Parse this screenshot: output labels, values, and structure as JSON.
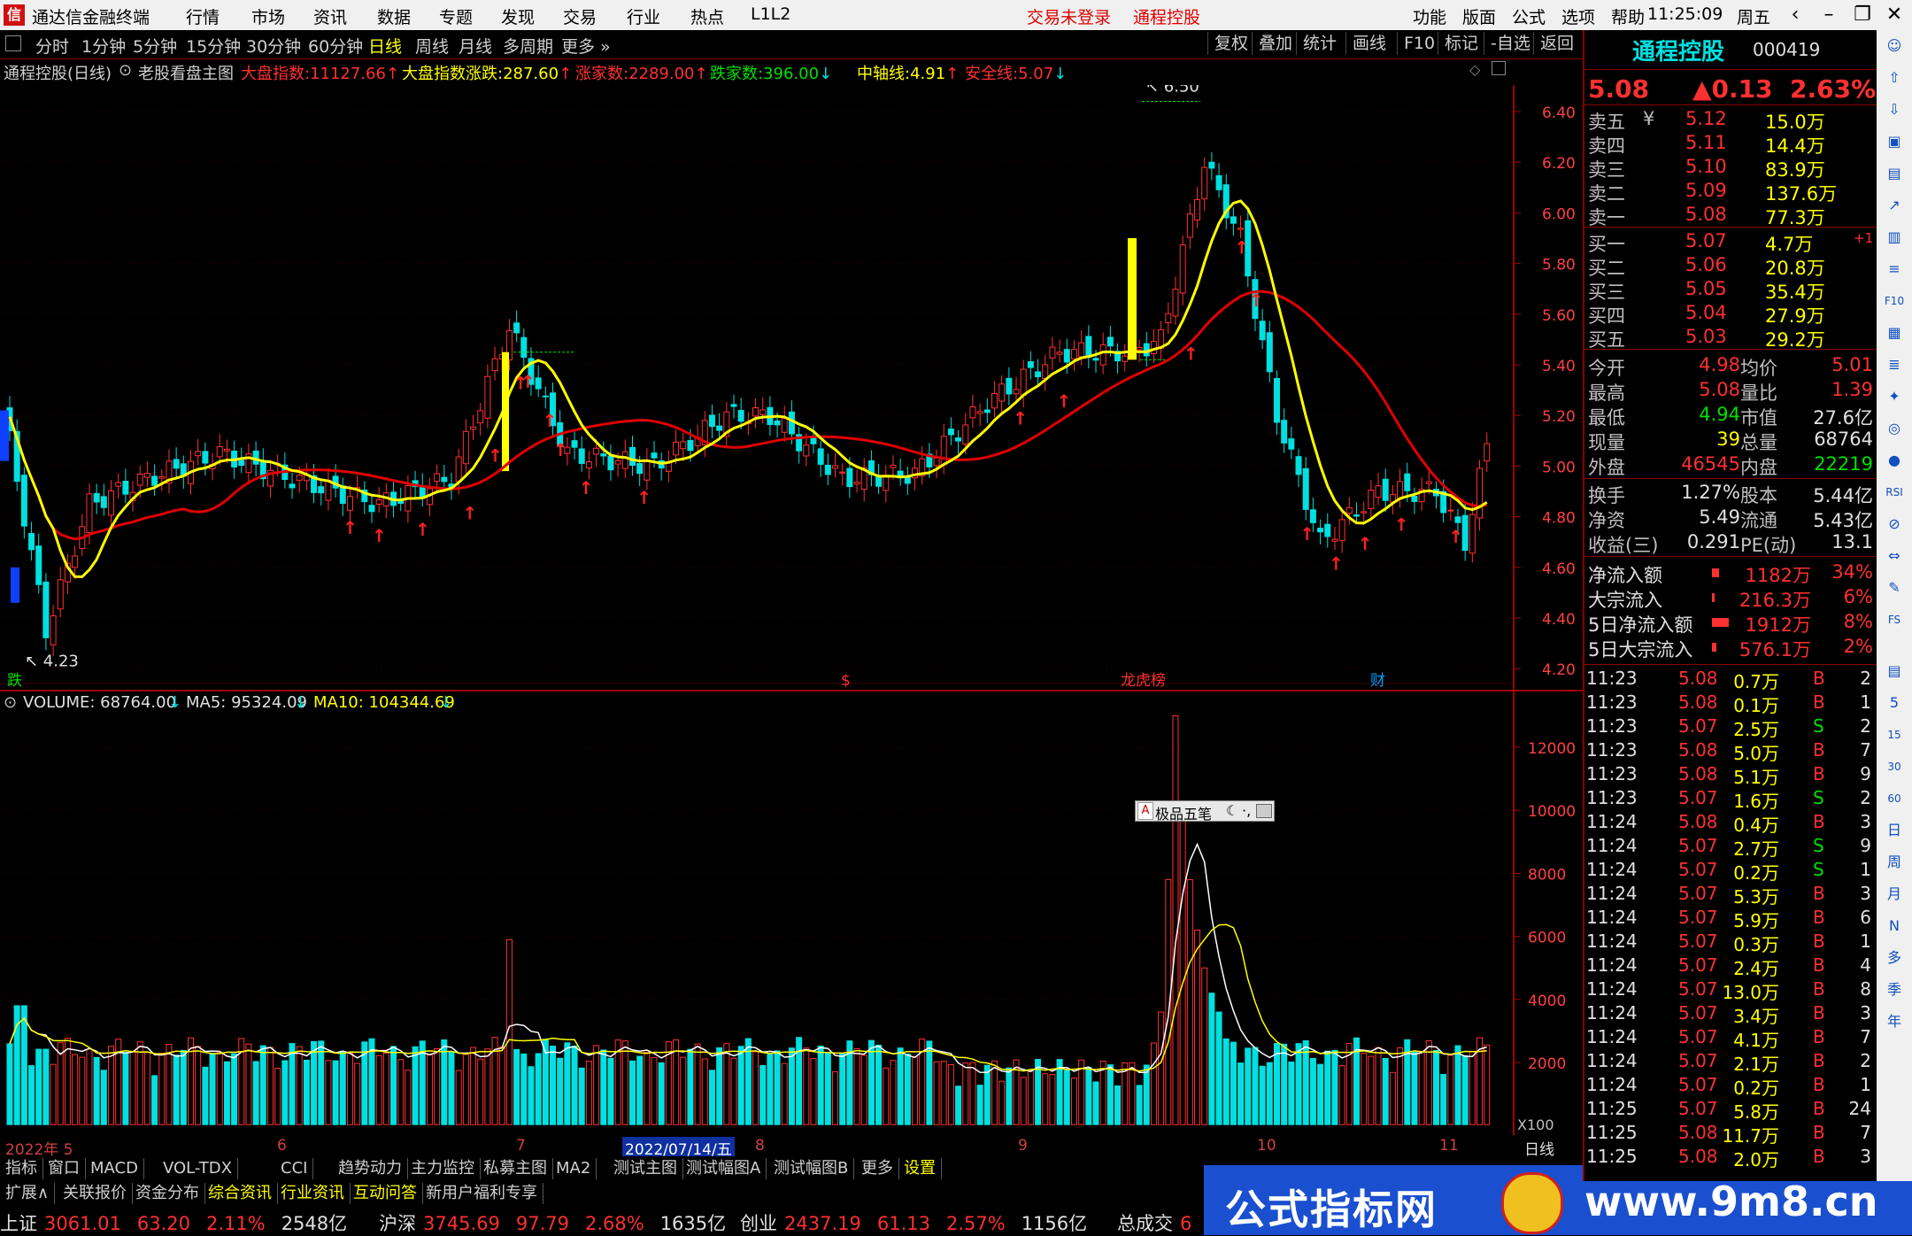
{
  "menubar": {
    "app_title": "通达信金融终端",
    "items": [
      "行情",
      "市场",
      "资讯",
      "数据",
      "专题",
      "发现",
      "交易",
      "行业",
      "热点",
      "L1L2"
    ],
    "login_status": "交易未登录",
    "stock_link": "通程控股",
    "right_items": [
      "功能",
      "版面",
      "公式",
      "选项",
      "帮助"
    ],
    "time": "11:25:09",
    "weekday": "周五"
  },
  "toolbar": {
    "periods": [
      "分时",
      "1分钟",
      "5分钟",
      "15分钟",
      "30分钟",
      "60分钟",
      "日线",
      "周线",
      "月线",
      "多周期",
      "更多 »"
    ],
    "active_period": "日线",
    "right_buttons": [
      "复权",
      "叠加",
      "统计",
      "画线",
      "F10",
      "标记",
      "-自选",
      "返回"
    ]
  },
  "chart_info": {
    "stock_period": "通程控股(日线)",
    "template": "老股看盘主图",
    "fields": [
      {
        "label": "大盘指数:",
        "value": "11127.66",
        "arrow": "↑",
        "label_color": "#ff3030",
        "value_color": "#ff3030"
      },
      {
        "label": "大盘指数涨跌:",
        "value": "287.60",
        "arrow": "↑",
        "label_color": "#ffff00",
        "value_color": "#ffff00"
      },
      {
        "label": "涨家数:",
        "value": "2289.00",
        "arrow": "↑",
        "label_color": "#ff3030",
        "value_color": "#ff3030"
      },
      {
        "label": "跌家数:",
        "value": "396.00",
        "arrow": "↓",
        "label_color": "#00e000",
        "value_color": "#00e000"
      },
      {
        "label": "中轴线:",
        "value": "4.91",
        "arrow": "↑",
        "label_color": "#ffff00",
        "value_color": "#ffff00"
      },
      {
        "label": "安全线:",
        "value": "5.07",
        "arrow": "↓",
        "label_color": "#ff3030",
        "value_color": "#ff3030"
      }
    ]
  },
  "volume_info": {
    "volume": "VOLUME: 68764.00",
    "ma5": "MA5: 95324.09",
    "ma10": "MA10: 104344.69"
  },
  "price_axis": [
    "6.40",
    "6.20",
    "6.00",
    "5.80",
    "5.60",
    "5.40",
    "5.20",
    "5.00",
    "4.80",
    "4.60",
    "4.40",
    "4.20"
  ],
  "volume_axis": [
    "12000",
    "10000",
    "8000",
    "6000",
    "4000",
    "2000"
  ],
  "volume_unit": "X100",
  "x_axis": {
    "labels": [
      "2022年 5",
      "6",
      "7",
      "8",
      "9",
      "10",
      "11"
    ],
    "cursor_date": "2022/07/14/五",
    "period": "日线"
  },
  "annotations": {
    "high": "6.50",
    "low": "4.23",
    "events": [
      "跌",
      "$",
      "龙虎榜",
      "财"
    ],
    "ime_label": "极品五笔"
  },
  "bottom_tabs": [
    "指标",
    "窗口",
    "MACD",
    "VOL-TDX",
    "CCI",
    "趋势动力",
    "主力监控",
    "私募主图",
    "MA2",
    "测试主图",
    "测试幅图A",
    "测试幅图B",
    "更多",
    "设置"
  ],
  "bottom_tabs2": [
    "扩展∧",
    "关联报价",
    "资金分布",
    "综合资讯",
    "行业资讯",
    "互动问答",
    "新用户福利专享"
  ],
  "status_bar": [
    {
      "name": "上证",
      "value": "3061.01",
      "change": "63.20",
      "pct": "2.11%",
      "amount": "2548亿"
    },
    {
      "name": "沪深",
      "value": "3745.69",
      "change": "97.79",
      "pct": "2.68%",
      "amount": "1635亿"
    },
    {
      "name": "创业",
      "value": "2437.19",
      "change": "61.13",
      "pct": "2.57%",
      "amount": "1156亿"
    },
    {
      "name": "总成交",
      "value": "6",
      "change": "",
      "pct": "",
      "amount": ""
    }
  ],
  "banner": {
    "left": "公式指标网",
    "right": "www.9m8.cn"
  },
  "quote": {
    "name": "通程控股",
    "code": "000419",
    "price": "5.08",
    "change": "▲0.13",
    "pct": "2.63%",
    "sells": [
      {
        "label": "卖五",
        "price": "5.12",
        "vol": "15.0万"
      },
      {
        "label": "卖四",
        "price": "5.11",
        "vol": "14.4万"
      },
      {
        "label": "卖三",
        "price": "5.10",
        "vol": "83.9万"
      },
      {
        "label": "卖二",
        "price": "5.09",
        "vol": "137.6万"
      },
      {
        "label": "卖一",
        "price": "5.08",
        "vol": "77.3万"
      }
    ],
    "sell_mark": "¥",
    "buys": [
      {
        "label": "买一",
        "price": "5.07",
        "vol": "4.7万",
        "extra": "+1"
      },
      {
        "label": "买二",
        "price": "5.06",
        "vol": "20.8万",
        "extra": ""
      },
      {
        "label": "买三",
        "price": "5.05",
        "vol": "35.4万",
        "extra": ""
      },
      {
        "label": "买四",
        "price": "5.04",
        "vol": "27.9万",
        "extra": ""
      },
      {
        "label": "买五",
        "price": "5.03",
        "vol": "29.2万",
        "extra": ""
      }
    ],
    "stats": [
      {
        "l1": "今开",
        "v1": "4.98",
        "c1": "#ff3030",
        "l2": "均价",
        "v2": "5.01",
        "c2": "#ff3030"
      },
      {
        "l1": "最高",
        "v1": "5.08",
        "c1": "#ff3030",
        "l2": "量比",
        "v2": "1.39",
        "c2": "#ff3030"
      },
      {
        "l1": "最低",
        "v1": "4.94",
        "c1": "#00e000",
        "l2": "市值",
        "v2": "27.6亿",
        "c2": "#e0e0e0"
      },
      {
        "l1": "现量",
        "v1": "39",
        "c1": "#ffff00",
        "l2": "总量",
        "v2": "68764",
        "c2": "#e0e0e0"
      },
      {
        "l1": "外盘",
        "v1": "46545",
        "c1": "#ff3030",
        "l2": "内盘",
        "v2": "22219",
        "c2": "#00e000"
      }
    ],
    "stats2": [
      {
        "l1": "换手",
        "v1": "1.27%",
        "l2": "股本",
        "v2": "5.44亿"
      },
      {
        "l1": "净资",
        "v1": "5.49",
        "l2": "流通",
        "v2": "5.43亿"
      },
      {
        "l1": "收益(三)",
        "v1": "0.291",
        "l2": "PE(动)",
        "v2": "13.1"
      }
    ],
    "flows": [
      {
        "label": "净流入额",
        "value": "1182万",
        "pct": "34%",
        "bar": 0.34
      },
      {
        "label": "大宗流入",
        "value": "216.3万",
        "pct": "6%",
        "bar": 0.06
      },
      {
        "label": "5日净流入额",
        "value": "1912万",
        "pct": "8%",
        "bar": 0.8
      },
      {
        "label": "5日大宗流入",
        "value": "576.1万",
        "pct": "2%",
        "bar": 0.2
      }
    ]
  },
  "ticks": [
    {
      "t": "11:23",
      "p": "5.08",
      "v": "0.7万",
      "s": "B",
      "n": "2"
    },
    {
      "t": "11:23",
      "p": "5.08",
      "v": "0.1万",
      "s": "B",
      "n": "1"
    },
    {
      "t": "11:23",
      "p": "5.07",
      "v": "2.5万",
      "s": "S",
      "n": "2"
    },
    {
      "t": "11:23",
      "p": "5.08",
      "v": "5.0万",
      "s": "B",
      "n": "7"
    },
    {
      "t": "11:23",
      "p": "5.08",
      "v": "5.1万",
      "s": "B",
      "n": "9"
    },
    {
      "t": "11:23",
      "p": "5.07",
      "v": "1.6万",
      "s": "S",
      "n": "2"
    },
    {
      "t": "11:24",
      "p": "5.08",
      "v": "0.4万",
      "s": "B",
      "n": "3"
    },
    {
      "t": "11:24",
      "p": "5.07",
      "v": "2.7万",
      "s": "S",
      "n": "9"
    },
    {
      "t": "11:24",
      "p": "5.07",
      "v": "0.2万",
      "s": "S",
      "n": "1"
    },
    {
      "t": "11:24",
      "p": "5.07",
      "v": "5.3万",
      "s": "B",
      "n": "3"
    },
    {
      "t": "11:24",
      "p": "5.07",
      "v": "5.9万",
      "s": "B",
      "n": "6"
    },
    {
      "t": "11:24",
      "p": "5.07",
      "v": "0.3万",
      "s": "B",
      "n": "1"
    },
    {
      "t": "11:24",
      "p": "5.07",
      "v": "2.4万",
      "s": "B",
      "n": "4"
    },
    {
      "t": "11:24",
      "p": "5.07",
      "v": "13.0万",
      "s": "B",
      "n": "8"
    },
    {
      "t": "11:24",
      "p": "5.07",
      "v": "3.4万",
      "s": "B",
      "n": "3"
    },
    {
      "t": "11:24",
      "p": "5.07",
      "v": "4.1万",
      "s": "B",
      "n": "7"
    },
    {
      "t": "11:24",
      "p": "5.07",
      "v": "2.1万",
      "s": "B",
      "n": "2"
    },
    {
      "t": "11:24",
      "p": "5.07",
      "v": "0.2万",
      "s": "B",
      "n": "1"
    },
    {
      "t": "11:25",
      "p": "5.07",
      "v": "5.8万",
      "s": "B",
      "n": "24"
    },
    {
      "t": "11:25",
      "p": "5.08",
      "v": "11.7万",
      "s": "B",
      "n": "7"
    },
    {
      "t": "11:25",
      "p": "5.08",
      "v": "2.0万",
      "s": "B",
      "n": "3"
    }
  ],
  "side_icons": [
    "☺",
    "⇧",
    "⇩",
    "▣",
    "▤",
    "↗",
    "▥",
    "≡",
    "F10",
    "▦",
    "≣",
    "✦",
    "◎",
    "●",
    "RSI",
    "⊘",
    "⇔",
    "✎",
    "FS",
    "▤",
    "5",
    "15",
    "30",
    "60",
    "日",
    "周",
    "月",
    "N",
    "多",
    "季",
    "年"
  ],
  "colors": {
    "up": "#ff3030",
    "down": "#00e0e0",
    "ma5": "#ffff00",
    "ma10": "#e00000",
    "bg": "#000000"
  }
}
